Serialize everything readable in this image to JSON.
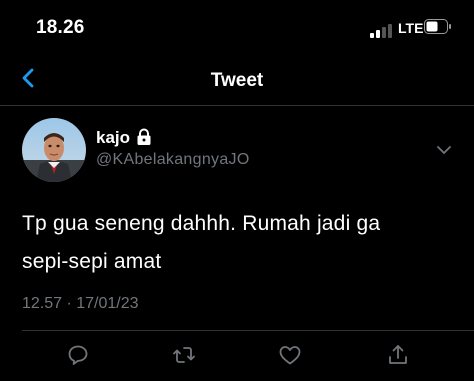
{
  "status_bar": {
    "time": "18.26",
    "network": "LTE",
    "signal_icon": "signal-bars-icon",
    "battery_icon": "battery-icon"
  },
  "nav": {
    "title": "Tweet",
    "back_icon": "chevron-left-icon"
  },
  "tweet": {
    "display_name": "kajo",
    "handle": "@KAbelakangnyaJO",
    "protected_icon": "lock-icon",
    "text_line1": "Tp gua seneng dahhh. Rumah jadi ga",
    "text_line2": "sepi-sepi amat",
    "timestamp": "12.57 · 17/01/23"
  },
  "actions": [
    "reply-icon",
    "retweet-icon",
    "like-icon",
    "share-icon"
  ],
  "colors": {
    "background": "#000000",
    "accent": "#1d9bf0",
    "secondary_text": "#71767b",
    "divider": "#2f3336"
  }
}
